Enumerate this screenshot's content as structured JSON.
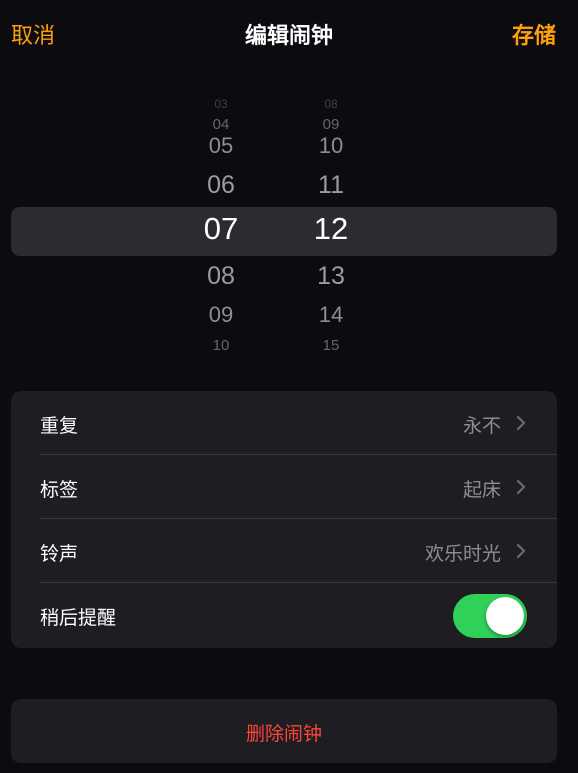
{
  "nav": {
    "cancel_label": "取消",
    "title": "编辑闹钟",
    "save_label": "存储"
  },
  "picker": {
    "hours": [
      "03",
      "04",
      "05",
      "06",
      "07",
      "08",
      "09",
      "10"
    ],
    "minutes": [
      "08",
      "09",
      "10",
      "11",
      "12",
      "13",
      "14",
      "15"
    ],
    "selected_hour": "07",
    "selected_minute": "12"
  },
  "settings": {
    "repeat": {
      "label": "重复",
      "value": "永不"
    },
    "label": {
      "label": "标签",
      "value": "起床"
    },
    "sound": {
      "label": "铃声",
      "value": "欢乐时光"
    },
    "snooze": {
      "label": "稍后提醒",
      "enabled": true
    }
  },
  "delete_label": "删除闹钟",
  "colors": {
    "accent": "#ff9f0a",
    "toggle_on": "#30d158",
    "destructive": "#ff453a",
    "background": "#0c0b10",
    "card": "#1e1d22"
  }
}
